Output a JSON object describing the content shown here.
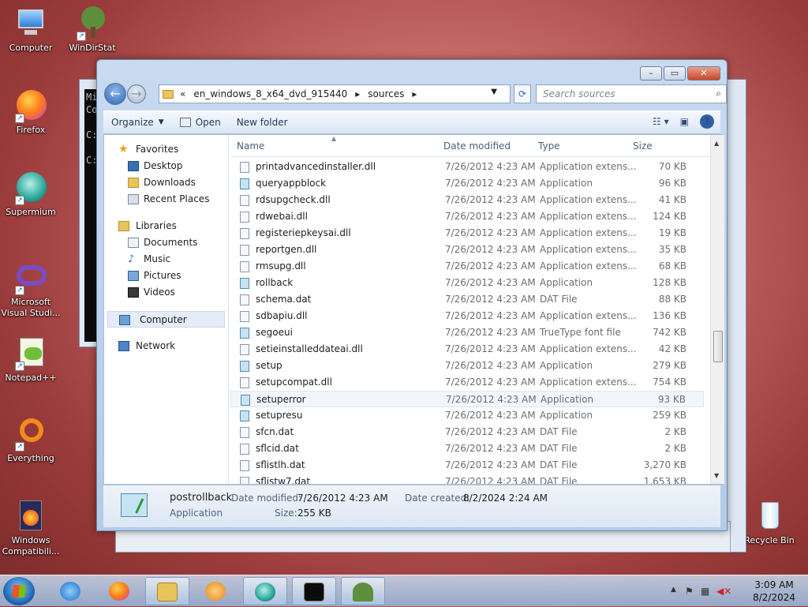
{
  "desktop": {
    "icons": [
      {
        "label": "Computer"
      },
      {
        "label": "WinDirStat"
      },
      {
        "label": "Firefox"
      },
      {
        "label": "Supermium"
      },
      {
        "label": "Microsoft Visual Studi..."
      },
      {
        "label": "Notepad++"
      },
      {
        "label": "Everything"
      },
      {
        "label": "Windows Compatibili..."
      },
      {
        "label": "Recycle Bin"
      }
    ]
  },
  "console": {
    "lines": [
      "Mi",
      "Co",
      "",
      "C:",
      "",
      "C:"
    ]
  },
  "explorer": {
    "breadcrumb": {
      "chevrons": "«",
      "parts": [
        "en_windows_8_x64_dvd_915440",
        "sources"
      ]
    },
    "search_placeholder": "Search sources",
    "toolbar": {
      "organize": "Organize",
      "open": "Open",
      "new_folder": "New folder"
    },
    "nav": {
      "favorites": "Favorites",
      "fav_items": [
        "Desktop",
        "Downloads",
        "Recent Places"
      ],
      "libraries": "Libraries",
      "lib_items": [
        "Documents",
        "Music",
        "Pictures",
        "Videos"
      ],
      "computer": "Computer",
      "network": "Network"
    },
    "columns": {
      "name": "Name",
      "date": "Date modified",
      "type": "Type",
      "size": "Size"
    },
    "files": [
      {
        "name": "printadvancedinstaller.dll",
        "date": "7/26/2012 4:23 AM",
        "type": "Application extens...",
        "size": "70 KB",
        "kind": "dll"
      },
      {
        "name": "queryappblock",
        "date": "7/26/2012 4:23 AM",
        "type": "Application",
        "size": "96 KB",
        "kind": "app"
      },
      {
        "name": "rdsupgcheck.dll",
        "date": "7/26/2012 4:23 AM",
        "type": "Application extens...",
        "size": "41 KB",
        "kind": "dll"
      },
      {
        "name": "rdwebai.dll",
        "date": "7/26/2012 4:23 AM",
        "type": "Application extens...",
        "size": "124 KB",
        "kind": "dll"
      },
      {
        "name": "registeriepkeysai.dll",
        "date": "7/26/2012 4:23 AM",
        "type": "Application extens...",
        "size": "19 KB",
        "kind": "dll"
      },
      {
        "name": "reportgen.dll",
        "date": "7/26/2012 4:23 AM",
        "type": "Application extens...",
        "size": "35 KB",
        "kind": "dll"
      },
      {
        "name": "rmsupg.dll",
        "date": "7/26/2012 4:23 AM",
        "type": "Application extens...",
        "size": "68 KB",
        "kind": "dll"
      },
      {
        "name": "rollback",
        "date": "7/26/2012 4:23 AM",
        "type": "Application",
        "size": "128 KB",
        "kind": "app"
      },
      {
        "name": "schema.dat",
        "date": "7/26/2012 4:23 AM",
        "type": "DAT File",
        "size": "88 KB",
        "kind": "dat"
      },
      {
        "name": "sdbapiu.dll",
        "date": "7/26/2012 4:23 AM",
        "type": "Application extens...",
        "size": "136 KB",
        "kind": "dll"
      },
      {
        "name": "segoeui",
        "date": "7/26/2012 4:23 AM",
        "type": "TrueType font file",
        "size": "742 KB",
        "kind": "font"
      },
      {
        "name": "setieinstalleddateai.dll",
        "date": "7/26/2012 4:23 AM",
        "type": "Application extens...",
        "size": "42 KB",
        "kind": "dll"
      },
      {
        "name": "setup",
        "date": "7/26/2012 4:23 AM",
        "type": "Application",
        "size": "279 KB",
        "kind": "app"
      },
      {
        "name": "setupcompat.dll",
        "date": "7/26/2012 4:23 AM",
        "type": "Application extens...",
        "size": "754 KB",
        "kind": "dll"
      },
      {
        "name": "setuperror",
        "date": "7/26/2012 4:23 AM",
        "type": "Application",
        "size": "93 KB",
        "kind": "app"
      },
      {
        "name": "setupresu",
        "date": "7/26/2012 4:23 AM",
        "type": "Application",
        "size": "259 KB",
        "kind": "app"
      },
      {
        "name": "sfcn.dat",
        "date": "7/26/2012 4:23 AM",
        "type": "DAT File",
        "size": "2 KB",
        "kind": "dat"
      },
      {
        "name": "sflcid.dat",
        "date": "7/26/2012 4:23 AM",
        "type": "DAT File",
        "size": "2 KB",
        "kind": "dat"
      },
      {
        "name": "sflistlh.dat",
        "date": "7/26/2012 4:23 AM",
        "type": "DAT File",
        "size": "3,270 KB",
        "kind": "dat"
      },
      {
        "name": "sflistw7.dat",
        "date": "7/26/2012 4:23 AM",
        "type": "DAT File",
        "size": "1,653 KB",
        "kind": "dat"
      }
    ],
    "details": {
      "name": "postrollback",
      "type": "Application",
      "date_modified_label": "Date modified:",
      "date_modified": "7/26/2012 4:23 AM",
      "date_created_label": "Date created:",
      "date_created": "8/2/2024 2:24 AM",
      "size_label": "Size:",
      "size": "255 KB"
    }
  },
  "taskbar": {
    "time": "3:09 AM",
    "date": "8/2/2024"
  }
}
